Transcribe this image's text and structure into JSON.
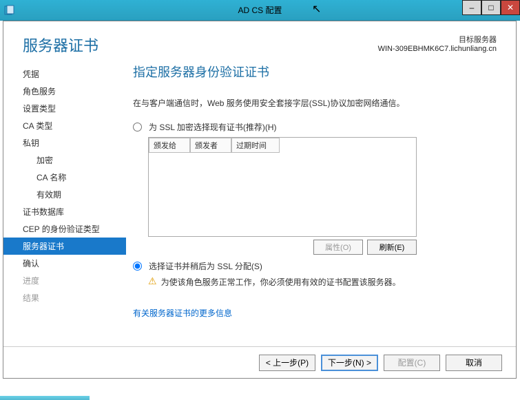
{
  "titlebar": {
    "title": "AD CS 配置"
  },
  "header": {
    "title": "服务器证书",
    "target_label": "目标服务器",
    "target_host": "WIN-309EBHMK6C7.lichunliang.cn"
  },
  "sidebar": {
    "items": [
      {
        "label": "凭据",
        "selected": false,
        "sub": false,
        "disabled": false
      },
      {
        "label": "角色服务",
        "selected": false,
        "sub": false,
        "disabled": false
      },
      {
        "label": "设置类型",
        "selected": false,
        "sub": false,
        "disabled": false
      },
      {
        "label": "CA 类型",
        "selected": false,
        "sub": false,
        "disabled": false
      },
      {
        "label": "私钥",
        "selected": false,
        "sub": false,
        "disabled": false
      },
      {
        "label": "加密",
        "selected": false,
        "sub": true,
        "disabled": false
      },
      {
        "label": "CA 名称",
        "selected": false,
        "sub": true,
        "disabled": false
      },
      {
        "label": "有效期",
        "selected": false,
        "sub": true,
        "disabled": false
      },
      {
        "label": "证书数据库",
        "selected": false,
        "sub": false,
        "disabled": false
      },
      {
        "label": "CEP 的身份验证类型",
        "selected": false,
        "sub": false,
        "disabled": false
      },
      {
        "label": "服务器证书",
        "selected": true,
        "sub": false,
        "disabled": false
      },
      {
        "label": "确认",
        "selected": false,
        "sub": false,
        "disabled": false
      },
      {
        "label": "进度",
        "selected": false,
        "sub": false,
        "disabled": true
      },
      {
        "label": "结果",
        "selected": false,
        "sub": false,
        "disabled": true
      }
    ]
  },
  "content": {
    "heading": "指定服务器身份验证证书",
    "desc": "在与客户端通信时，Web 服务使用安全套接字层(SSL)协议加密网络通信。",
    "opt_existing": "为 SSL 加密选择现有证书(推荐)(H)",
    "cert_columns": [
      "颁发给",
      "颁发者",
      "过期时间"
    ],
    "btn_properties": "属性(O)",
    "btn_refresh": "刷新(E)",
    "opt_later": "选择证书并稍后为 SSL 分配(S)",
    "warning": "为使该角色服务正常工作，你必须使用有效的证书配置该服务器。",
    "more_link": "有关服务器证书的更多信息"
  },
  "footer": {
    "prev": "< 上一步(P)",
    "next": "下一步(N) >",
    "configure": "配置(C)",
    "cancel": "取消"
  }
}
